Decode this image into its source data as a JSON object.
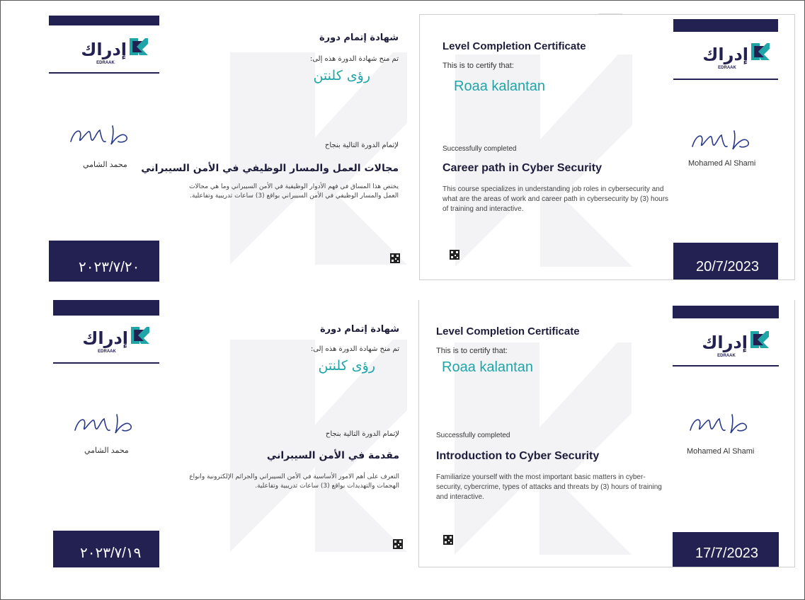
{
  "brand": {
    "logo_ar": "إدراك",
    "logo_en": "EDRAAK",
    "navy": "#232052",
    "teal": "#1fa5a8",
    "logo_icon": "edraak-k-icon"
  },
  "certificates": [
    {
      "ar": {
        "title": "شهادة إتمام دورة",
        "awarded_to": "تم منح شهادة الدورة هذه إلى:",
        "name": "رؤى كلنتن",
        "completed": "لإتمام الدورة التالية بنجاح",
        "course": "مجالات العمل والمسار الوظيفي في الأمن السيبراني",
        "desc": "يختص هذا المساق في فهم الأدوار الوظيفية في الأمن السيبراني وما هي مجالات العمل والمسار الوظيفي في الأمن السيبراني بواقع (3) ساعات تدريبية وتفاعلية.",
        "signer": "محمد الشامي",
        "date": "٢٠٢٣/٧/٢٠"
      },
      "en": {
        "title": "Level Completion Certificate",
        "certify": "This is to certify that:",
        "name": "Roaa kalantan",
        "completed": "Successfully completed",
        "course": "Career path in Cyber Security",
        "desc": "This course specializes in understanding job roles in cybersecurity and what are the areas of work and career path in cybersecurity by (3) hours of training and interactive.",
        "signer": "Mohamed Al Shami",
        "date": "20/7/2023"
      }
    },
    {
      "ar": {
        "title": "شهادة إتمام دورة",
        "awarded_to": "تم منح شهادة الدورة هذه إلى:",
        "name": "رؤى كلنتن",
        "completed": "لإتمام الدورة التالية بنجاح",
        "course": "مقدمة في الأمن السيبراني",
        "desc": "التعرف على أهم الامور الأساسية في الأمن السيبراني والجرائم الإلكترونية وانواع الهجمات والتهديدات بواقع (3) ساعات تدريبية وتفاعلية.",
        "signer": "محمد الشامي",
        "date": "٢٠٢٣/٧/١٩"
      },
      "en": {
        "title": "Level Completion Certificate",
        "certify": "This is to certify that:",
        "name": "Roaa kalantan",
        "completed": "Successfully completed",
        "course": "Introduction to Cyber Security",
        "desc": "Familiarize yourself with the most important basic matters in cyber-security, cybercrime, types of attacks and threats by (3) hours of training and interactive.",
        "signer": "Mohamed Al Shami",
        "date": "17/7/2023"
      }
    }
  ]
}
